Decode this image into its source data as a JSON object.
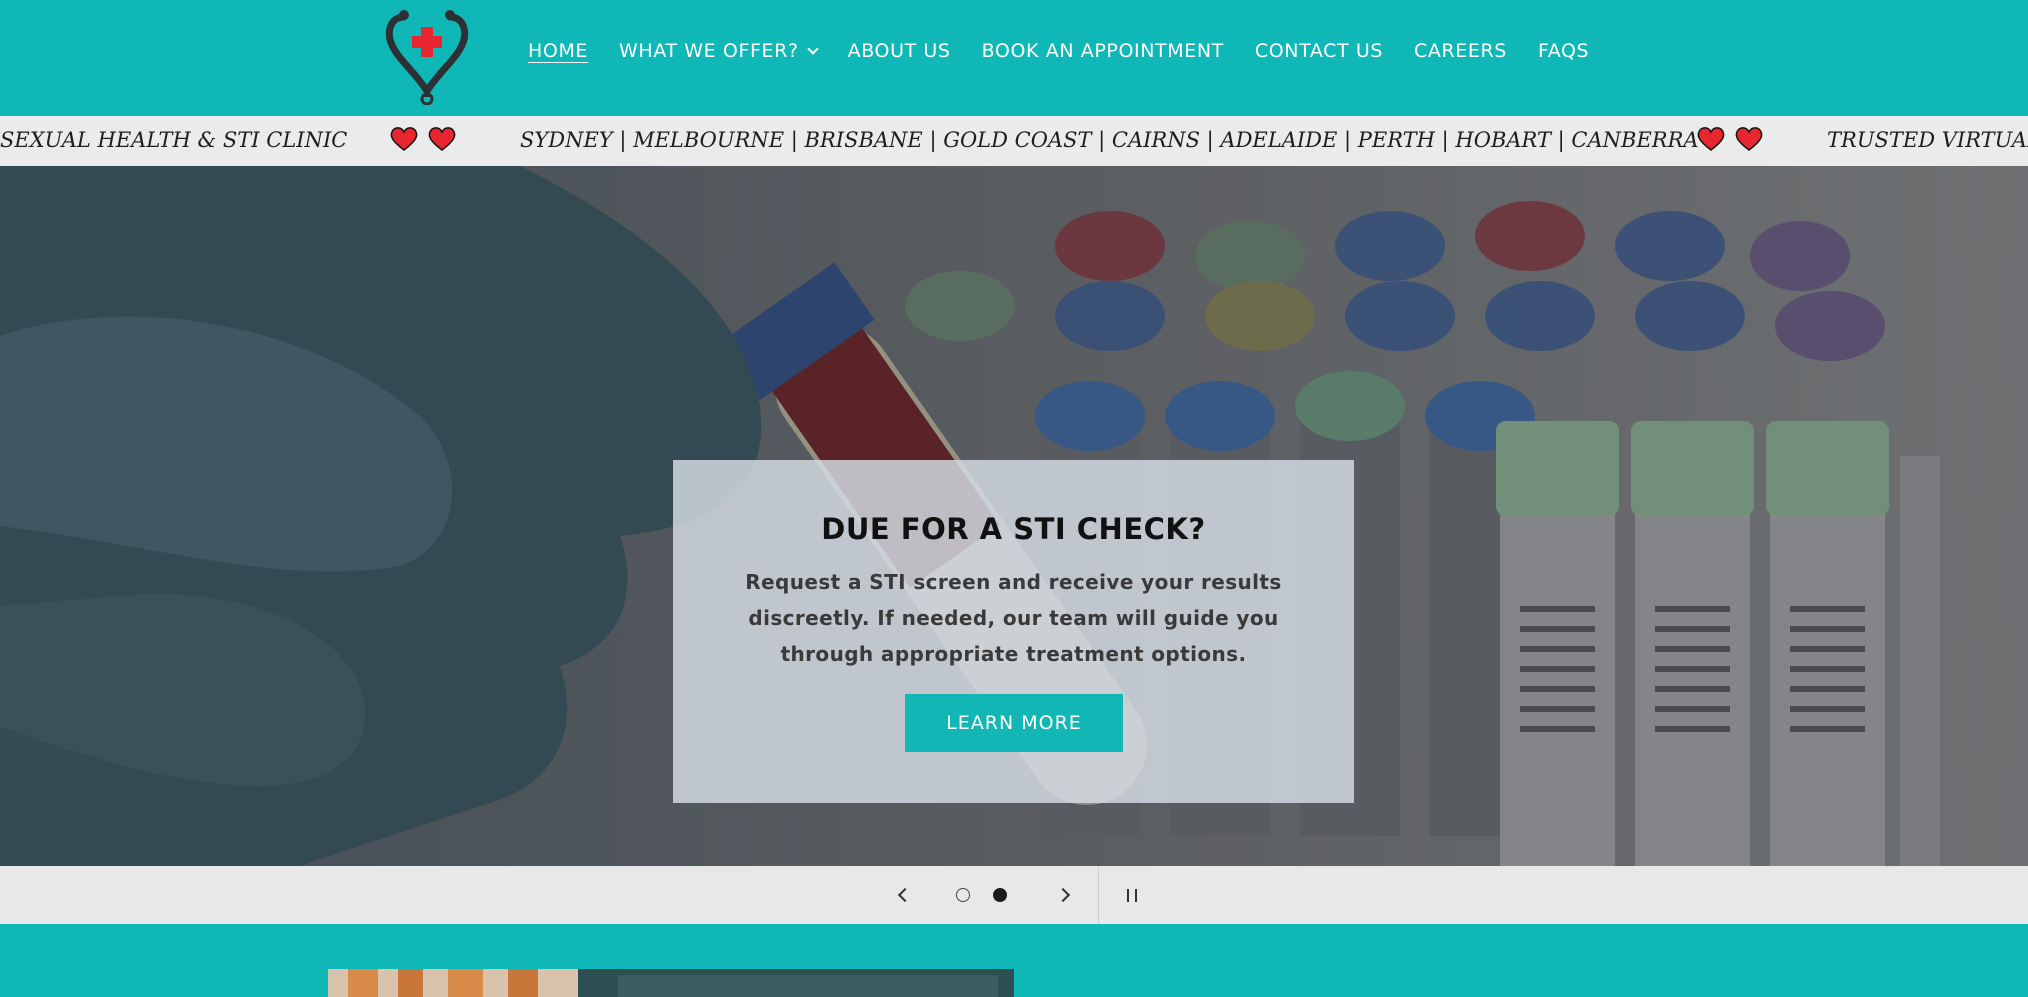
{
  "nav": {
    "items": [
      {
        "label": "HOME",
        "active": true
      },
      {
        "label": "WHAT WE OFFER?",
        "has_dropdown": true
      },
      {
        "label": "ABOUT US"
      },
      {
        "label": "BOOK AN APPOINTMENT"
      },
      {
        "label": "CONTACT US"
      },
      {
        "label": "CAREERS"
      },
      {
        "label": "FAQS"
      }
    ],
    "logo_icon": "heart-stethoscope-logo"
  },
  "marquee": {
    "segment1": "SEXUAL HEALTH & STI CLINIC",
    "segment2": "SYDNEY | MELBOURNE | BRISBANE | GOLD COAST | CAIRNS | ADELAIDE | PERTH | HOBART | CANBERRA",
    "segment3": "TRUSTED VIRTUAL",
    "separator_icon": "heart-icon"
  },
  "hero": {
    "title": "DUE FOR A STI CHECK?",
    "description": "Request a STI screen and receive your results discreetly. If needed, our team will guide you through appropriate treatment options.",
    "button_label": "LEARN MORE"
  },
  "slider": {
    "slide_count": 2,
    "current_slide": 2
  },
  "colors": {
    "brand": "#0fb7b7",
    "button": "#11b6b5",
    "heart": "#e8262f"
  }
}
